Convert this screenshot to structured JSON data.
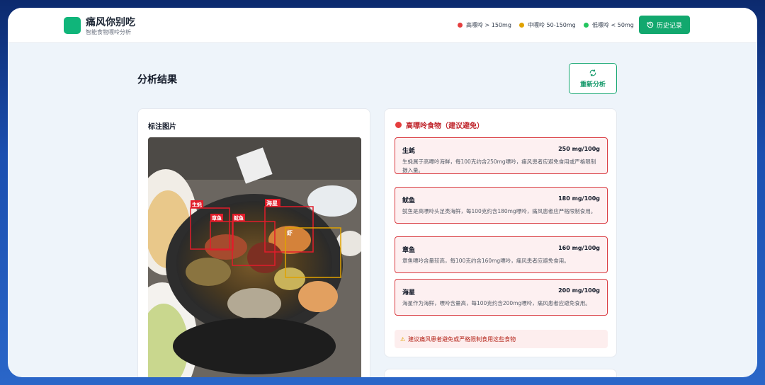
{
  "header": {
    "app_title": "痛风你别吃",
    "app_subtitle": "智能食物嘌呤分析",
    "legend": [
      {
        "label": "高嘌呤 > 150mg",
        "color": "#e53e3e"
      },
      {
        "label": "中嘌呤 50-150mg",
        "color": "#e0a200"
      },
      {
        "label": "低嘌呤 < 50mg",
        "color": "#22c55e"
      }
    ],
    "history_label": "历史记录",
    "history_icon": "history-icon"
  },
  "main": {
    "title": "分析结果",
    "reanalyze_label": "重新分析",
    "reanalyze_icon": "refresh-icon"
  },
  "image_card": {
    "title": "标注图片",
    "annotations": [
      "生蚝",
      "章鱼",
      "鱿鱼",
      "海星",
      "虾"
    ]
  },
  "high_purine": {
    "title": "高嘌呤食物（建议避免）",
    "items": [
      {
        "name": "生蚝",
        "value": "250 mg/100g",
        "desc": "生蚝属于高嘌呤海鲜，每100克约含250mg嘌呤，痛风患者应避免食用或严格限制摄入量。"
      },
      {
        "name": "鱿鱼",
        "value": "180 mg/100g",
        "desc": "鱿鱼是高嘌呤头足类海鲜，每100克约含180mg嘌呤，痛风患者应严格限制食用。"
      },
      {
        "name": "章鱼",
        "value": "160 mg/100g",
        "desc": "章鱼嘌呤含量较高，每100克约含160mg嘌呤，痛风患者应避免食用。"
      },
      {
        "name": "海星",
        "value": "200 mg/100g",
        "desc": "海星作为海鲜，嘌呤含量高，每100克约含200mg嘌呤，痛风患者应避免食用。"
      }
    ],
    "warning": "建议痛风患者避免或严格限制食用这些食物",
    "warning_icon": "warning-icon"
  }
}
